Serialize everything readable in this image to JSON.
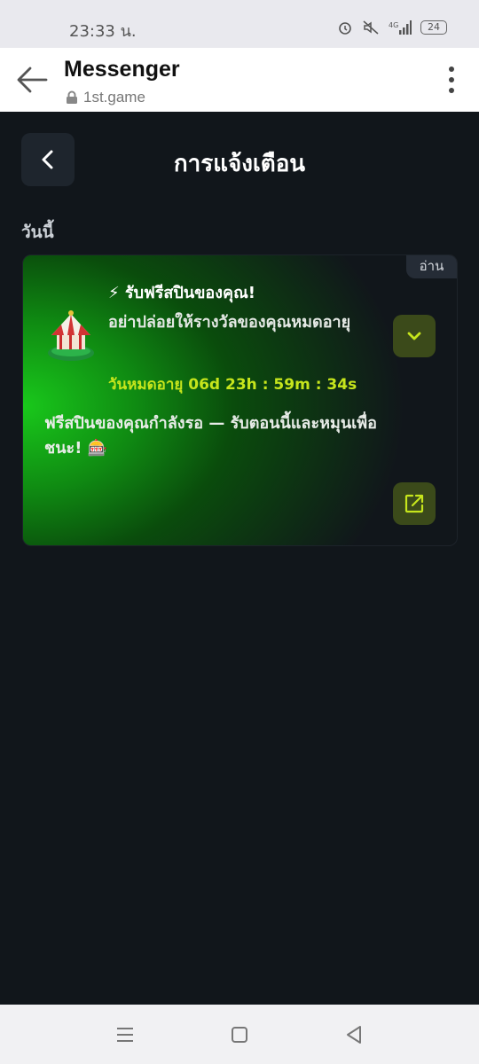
{
  "status_bar": {
    "time": "23:33 น.",
    "battery": "24"
  },
  "browser": {
    "title": "Messenger",
    "url": "1st.game"
  },
  "header": {
    "title": "การแจ้งเตือน"
  },
  "section": {
    "label": "วันนี้"
  },
  "notification": {
    "read_badge": "อ่าน",
    "title": "⚡ รับฟรีสปินของคุณ!",
    "subtitle": "อย่าปล่อยให้รางวัลของคุณหมดอายุ",
    "expiry_label": "วันหมดอายุ",
    "expiry_time": "06d 23h : 59m : 34s",
    "body": "ฟรีสปินของคุณกำลังรอ — รับตอนนี้และหมุนเพื่อชนะ! 🎰"
  },
  "colors": {
    "accent": "#c6e51c",
    "background": "#11161b",
    "card_green": "#19c81b"
  },
  "icons": {
    "browser_back": "arrow-left-icon",
    "menu": "kebab-menu-icon",
    "lock": "lock-icon",
    "header_back": "chevron-left-icon",
    "expand": "chevron-down-icon",
    "open": "external-link-icon",
    "thumbnail": "carousel-icon"
  }
}
